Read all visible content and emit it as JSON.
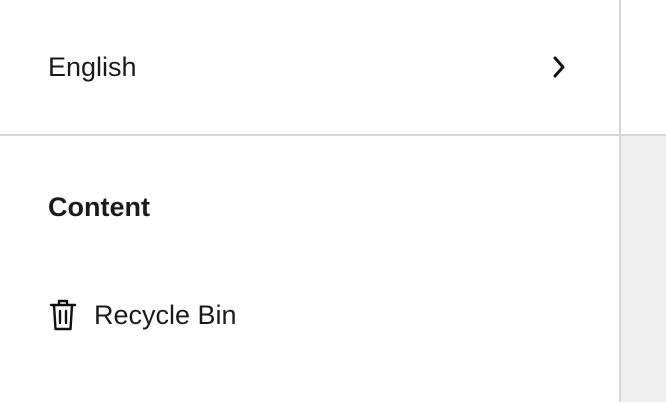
{
  "language_selector": {
    "label": "English",
    "icon": "chevron-right-icon"
  },
  "content_section": {
    "heading": "Content",
    "items": [
      {
        "label": "Recycle Bin",
        "icon": "trash-icon"
      }
    ]
  },
  "colors": {
    "sidebar_background": "#ffffff",
    "right_pane_background": "#efefef",
    "divider": "#d6d6d6",
    "text": "#1b1b1b"
  }
}
